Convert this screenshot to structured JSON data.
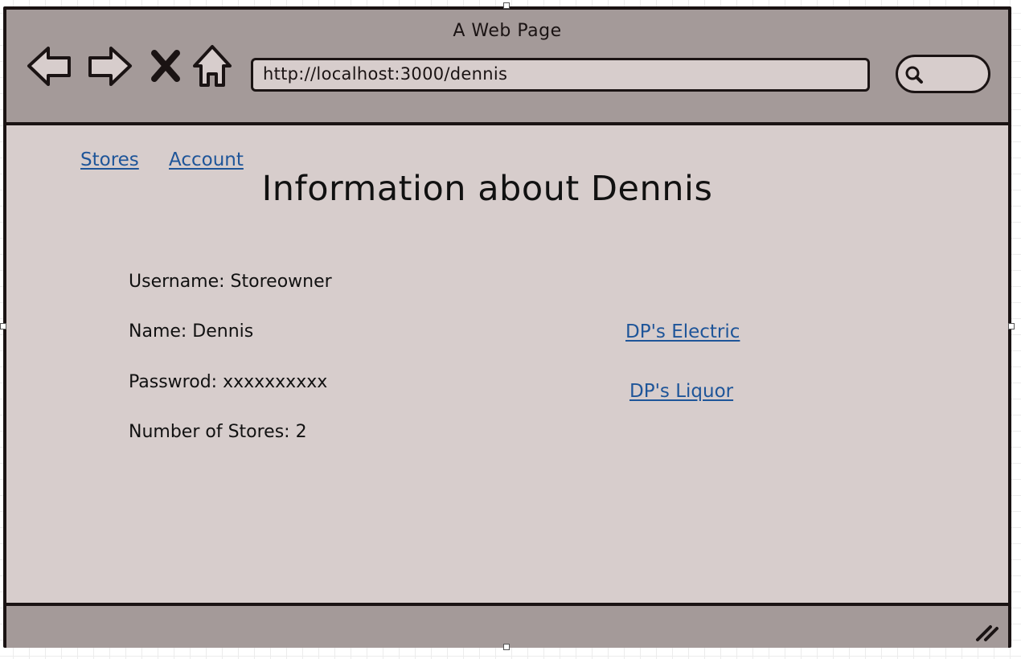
{
  "window": {
    "title": "A Web Page",
    "url": "http://localhost:3000/dennis"
  },
  "toolbar": {
    "icons": [
      "back-arrow-icon",
      "forward-arrow-icon",
      "close-x-icon",
      "home-icon",
      "search-icon"
    ]
  },
  "nav": {
    "stores": "Stores",
    "account": "Account"
  },
  "page": {
    "title": "Information about Dennis",
    "username": "Username: Storeowner",
    "name": "Name: Dennis",
    "password": "Passwrod: xxxxxxxxxx",
    "store_count": "Number of Stores: 2"
  },
  "stores": [
    {
      "label": "DP's Electric"
    },
    {
      "label": "DP's Liquor"
    }
  ],
  "colors": {
    "frame": "#a49a99",
    "content_bg": "#d7cdcc",
    "outline": "#1a1313",
    "link": "#1e5599"
  }
}
